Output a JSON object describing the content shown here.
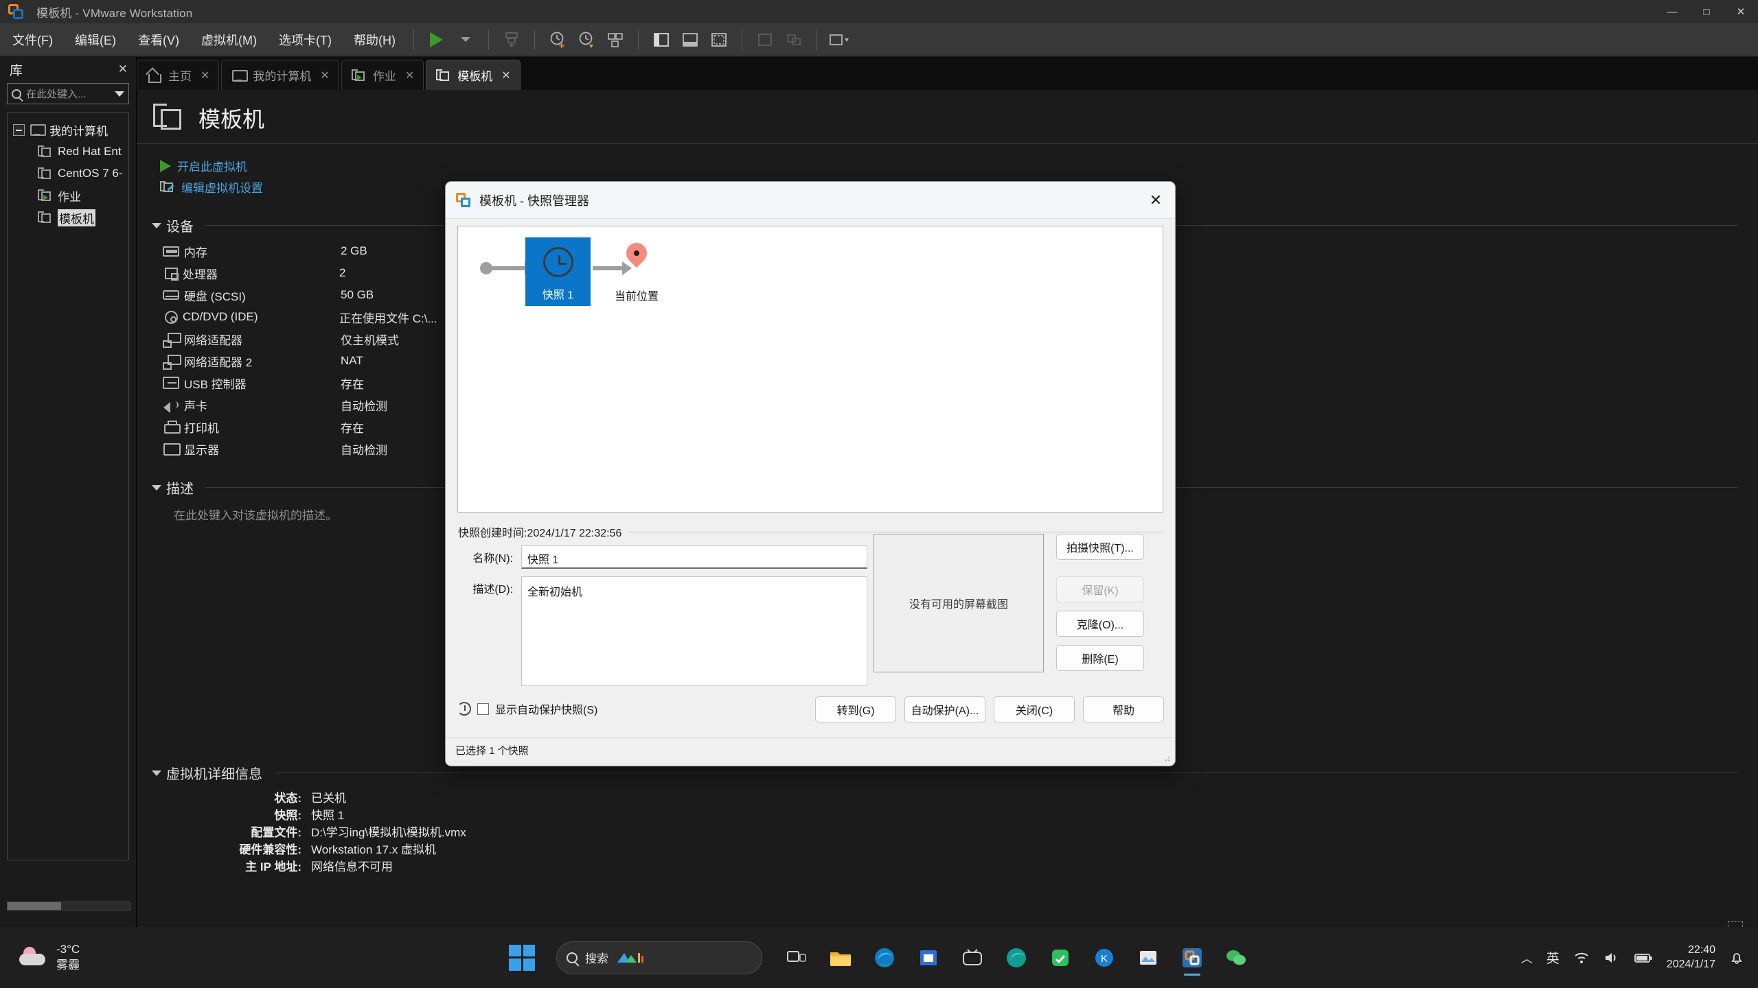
{
  "window": {
    "title": "模板机 - VMware Workstation",
    "icon": "vmware-logo-icon",
    "minimize_label": "—",
    "maximize_label": "□",
    "close_label": "✕"
  },
  "menubar": {
    "items": [
      {
        "label": "文件(F)",
        "name": "menu-file"
      },
      {
        "label": "编辑(E)",
        "name": "menu-edit"
      },
      {
        "label": "查看(V)",
        "name": "menu-view"
      },
      {
        "label": "虚拟机(M)",
        "name": "menu-vm"
      },
      {
        "label": "选项卡(T)",
        "name": "menu-tabs"
      },
      {
        "label": "帮助(H)",
        "name": "menu-help"
      }
    ],
    "toolbar_icons": [
      "power-on-icon",
      "power-dropdown-caret-icon",
      "snapshot-take-icon",
      "snapshot-clock-icon",
      "snapshot-revert-icon",
      "snapshot-manager-icon",
      "show-library-icon",
      "show-console-icon",
      "show-thumbnails-icon",
      "fullscreen-icon",
      "unity-icon",
      "layout-dropdown-icon"
    ]
  },
  "tabs": [
    {
      "label": "主页",
      "icon": "home-icon",
      "active": false,
      "close": "✕"
    },
    {
      "label": "我的计算机",
      "icon": "monitor-icon",
      "active": false,
      "close": "✕"
    },
    {
      "label": "作业",
      "icon": "vm-running-icon",
      "active": false,
      "close": "✕"
    },
    {
      "label": "模板机",
      "icon": "vm-icon",
      "active": true,
      "close": "✕"
    }
  ],
  "sidebar": {
    "title": "库",
    "close_label": "✕",
    "search": {
      "placeholder": "在此处键入...",
      "icon": "search-icon",
      "caret": "chevron-down-icon"
    },
    "tree": [
      {
        "label": "我的计算机",
        "icon": "monitor-icon",
        "level": 0,
        "expanded": true,
        "selected": false
      },
      {
        "label": "Red Hat Ent",
        "icon": "vm-icon",
        "level": 1,
        "selected": false
      },
      {
        "label": "CentOS 7 6-",
        "icon": "vm-icon",
        "level": 1,
        "selected": false
      },
      {
        "label": "作业",
        "icon": "vm-running-icon",
        "level": 1,
        "selected": false
      },
      {
        "label": "模板机",
        "icon": "vm-icon",
        "level": 1,
        "selected": true
      }
    ]
  },
  "main": {
    "vm_name": "模板机",
    "vm_icon": "vm-icon",
    "actions": [
      {
        "label": "开启此虚拟机",
        "icon": "play-icon"
      },
      {
        "label": "编辑虚拟机设置",
        "icon": "edit-settings-icon"
      }
    ],
    "devices_section": {
      "title": "设备",
      "rows": [
        {
          "label": "内存",
          "value": "2 GB",
          "icon": "memory-icon"
        },
        {
          "label": "处理器",
          "value": "2",
          "icon": "cpu-icon"
        },
        {
          "label": "硬盘 (SCSI)",
          "value": "50 GB",
          "icon": "harddisk-icon"
        },
        {
          "label": "CD/DVD (IDE)",
          "value": "正在使用文件 C:\\...",
          "icon": "cd-icon"
        },
        {
          "label": "网络适配器",
          "value": "仅主机模式",
          "icon": "network-icon"
        },
        {
          "label": "网络适配器 2",
          "value": "NAT",
          "icon": "network-icon"
        },
        {
          "label": "USB 控制器",
          "value": "存在",
          "icon": "usb-icon"
        },
        {
          "label": "声卡",
          "value": "自动检测",
          "icon": "sound-icon"
        },
        {
          "label": "打印机",
          "value": "存在",
          "icon": "printer-icon"
        },
        {
          "label": "显示器",
          "value": "自动检测",
          "icon": "display-icon"
        }
      ]
    },
    "description_section": {
      "title": "描述",
      "placeholder": "在此处键入对该虚拟机的描述。"
    },
    "details_section": {
      "title": "虚拟机详细信息",
      "rows": [
        {
          "key": "状态:",
          "value": "已关机"
        },
        {
          "key": "快照:",
          "value": "快照 1"
        },
        {
          "key": "配置文件:",
          "value": "D:\\学习ing\\模拟机\\模拟机.vmx"
        },
        {
          "key": "硬件兼容性:",
          "value": "Workstation 17.x 虚拟机"
        },
        {
          "key": "主 IP 地址:",
          "value": "网络信息不可用"
        }
      ]
    }
  },
  "dialog": {
    "title": "模板机 - 快照管理器",
    "icon": "vmware-logo-icon",
    "close_label": "✕",
    "tree": {
      "snapshot_label": "快照 1",
      "snapshot_icon": "clock-icon",
      "current_label": "当前位置",
      "current_icon": "location-pin-icon"
    },
    "snapshot_time_label": "快照创建时间:2024/1/17 22:32:56",
    "name_label": "名称(N):",
    "name_value": "快照 1",
    "desc_label": "描述(D):",
    "desc_value": "全新初始机",
    "preview_text": "没有可用的屏幕截图",
    "side_buttons": [
      {
        "label": "拍摄快照(T)...",
        "disabled": false
      },
      {
        "label": "保留(K)",
        "disabled": true
      },
      {
        "label": "克隆(O)...",
        "disabled": false
      },
      {
        "label": "删除(E)",
        "disabled": false
      }
    ],
    "auto_protect_checkbox": {
      "label": "显示自动保护快照(S)",
      "checked": false,
      "icon": "history-icon"
    },
    "footer_buttons": [
      {
        "label": "转到(G)"
      },
      {
        "label": "自动保护(A)..."
      },
      {
        "label": "关闭(C)"
      },
      {
        "label": "帮助"
      }
    ],
    "status_text": "已选择 1 个快照"
  },
  "taskbar": {
    "weather": {
      "temp": "-3°C",
      "condition": "雾霾",
      "icon": "weather-haze-icon"
    },
    "start_icon": "windows-start-icon",
    "search": {
      "placeholder": "搜索",
      "icon": "search-icon"
    },
    "apps": [
      {
        "name": "task-view",
        "icon": "task-view-icon"
      },
      {
        "name": "file-explorer",
        "icon": "folder-icon"
      },
      {
        "name": "edge",
        "icon": "edge-icon"
      },
      {
        "name": "microsoft-store",
        "icon": "store-icon"
      },
      {
        "name": "bilibili",
        "icon": "bilibili-icon"
      },
      {
        "name": "edge-dev",
        "icon": "edge-dev-icon"
      },
      {
        "name": "wechat-green",
        "icon": "green-app-icon"
      },
      {
        "name": "kugou",
        "icon": "k-app-icon"
      },
      {
        "name": "photos",
        "icon": "photos-icon"
      },
      {
        "name": "vmware-workstation",
        "icon": "vmware-logo-icon",
        "active": true
      },
      {
        "name": "wechat",
        "icon": "wechat-icon"
      }
    ],
    "tray": {
      "chevron": "chevron-up-icon",
      "ime": "英",
      "wifi": "wifi-icon",
      "volume": "volume-icon",
      "battery": "battery-icon",
      "notification": "bell-icon"
    },
    "clock": {
      "time": "22:40",
      "date": "2024/1/17"
    }
  }
}
